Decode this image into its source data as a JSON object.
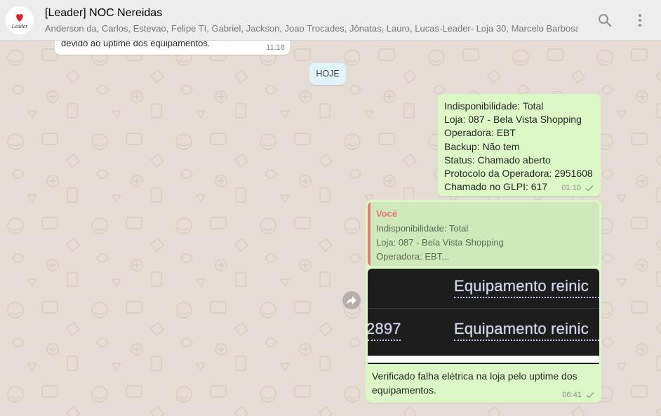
{
  "header": {
    "title": "[Leader] NOC Nereidas",
    "participants": "Anderson da, Carlos, Estevao, Felipe TI, Gabriel, Jackson, Joao Trocades, Jônatas, Lauro, Lucas-Leader- Loja 30, Marcelo Barbosa(Le...",
    "avatar_text": "Leader",
    "icons": [
      "search-icon",
      "menu-icon"
    ]
  },
  "chat": {
    "previous_message": {
      "text": "devido ao uptime dos equipamentos.",
      "time": "11:18"
    },
    "date_divider": "HOJE",
    "messages": [
      {
        "lines": [
          "Indisponibilidade: Total",
          "Loja: 087 - Bela Vista Shopping",
          "Operadora: EBT",
          "Backup: Não tem",
          "Status: Chamado aberto",
          "Protocolo da Operadora: 2951608",
          "Chamado no GLPI: 617"
        ],
        "time": "01:10"
      },
      {
        "quote": {
          "author": "Você",
          "lines": [
            "Indisponibilidade: Total",
            "Loja: 087 - Bela Vista Shopping",
            "Operadora: EBT..."
          ]
        },
        "media": {
          "row1": "Equipamento reinic",
          "row2_left": "2897",
          "row2_right": "Equipamento reinic"
        },
        "caption": "Verificado falha elétrica na loja pelo uptime dos equipamentos.",
        "time": "06:41"
      }
    ]
  },
  "colors": {
    "background": "#e5ddd5",
    "outgoing": "#dcf8c6",
    "incoming": "#ffffff",
    "quote_accent": "#e8787c",
    "date_pill": "#e1f3fb"
  }
}
